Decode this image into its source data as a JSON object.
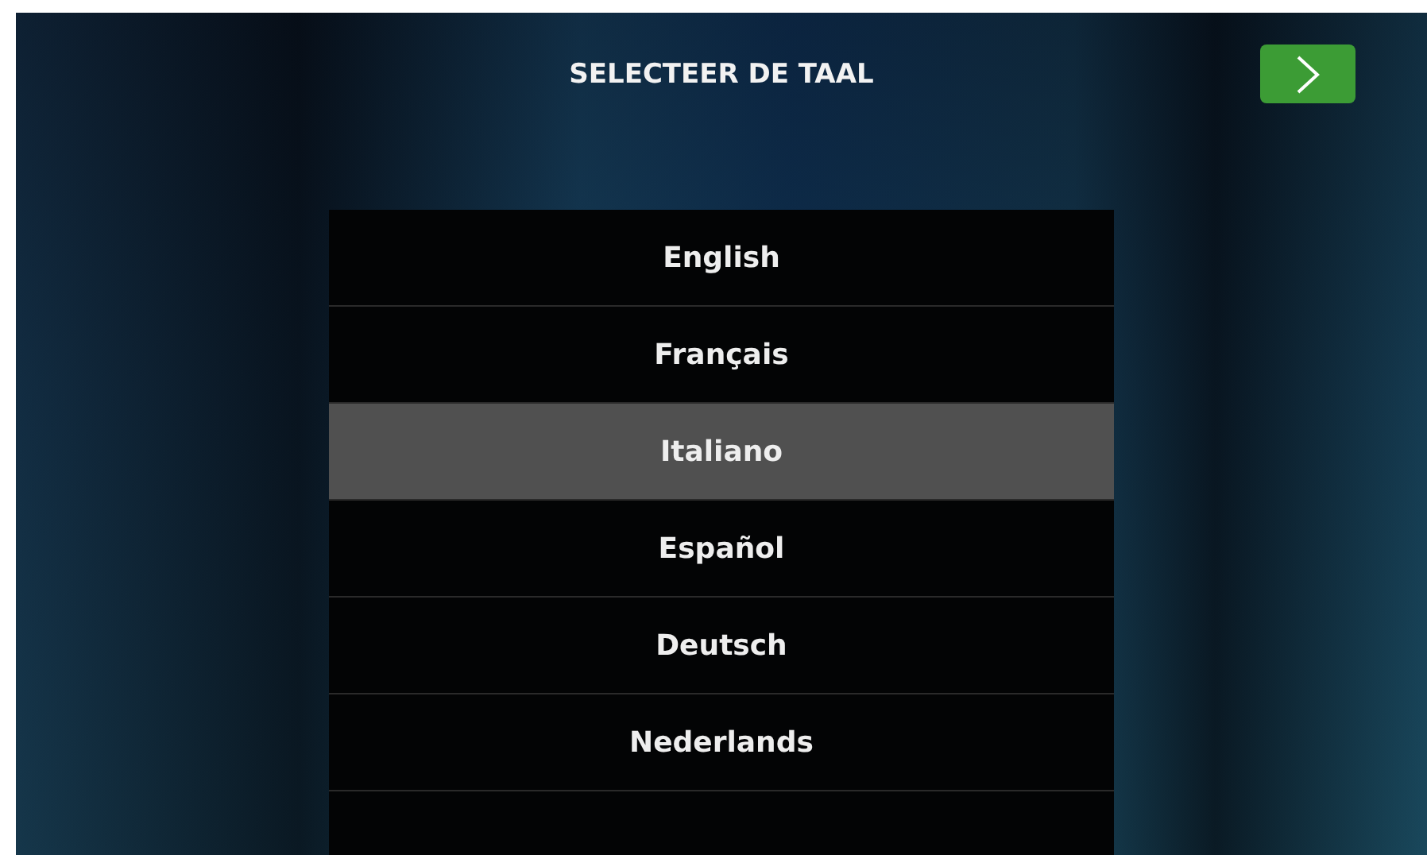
{
  "title": "SELECTEER DE TAAL",
  "languages": [
    {
      "label": "English",
      "selected": false
    },
    {
      "label": "Français",
      "selected": false
    },
    {
      "label": "Italiano",
      "selected": true
    },
    {
      "label": "Español",
      "selected": false
    },
    {
      "label": "Deutsch",
      "selected": false
    },
    {
      "label": "Nederlands",
      "selected": false
    }
  ]
}
